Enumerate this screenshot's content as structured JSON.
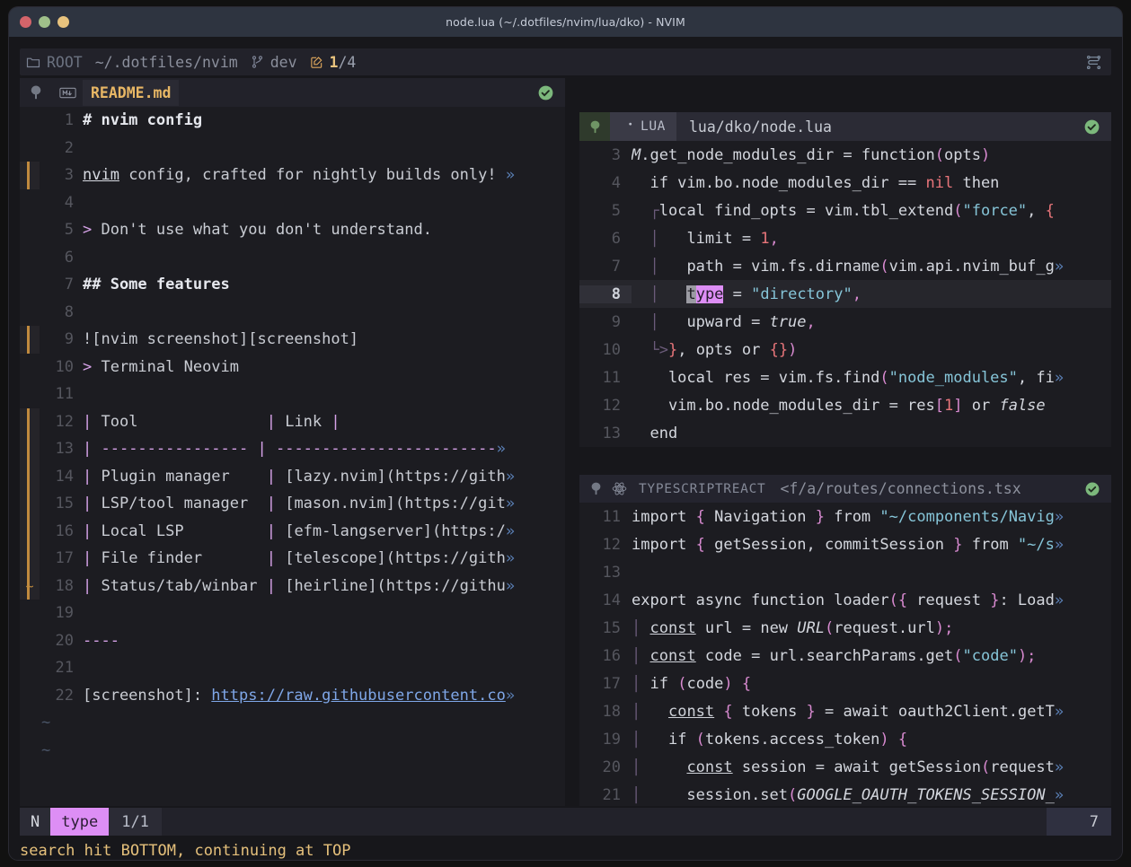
{
  "window": {
    "title": "node.lua (~/.dotfiles/nvim/lua/dko) - NVIM",
    "traffic_lights": [
      "close",
      "minimize",
      "maximize"
    ]
  },
  "tabline": {
    "folder_icon": "folder-icon",
    "root_label": "ROOT",
    "path": "~/.dotfiles/nvim",
    "branch_icon": "git-branch-icon",
    "branch": "dev",
    "edit_icon": "pencil-square-icon",
    "count_current": "1",
    "count_sep": "/4",
    "right_icon": "sitemap-icon"
  },
  "left_pane": {
    "winbar": {
      "tree_icon": "tree-icon",
      "filetype_icon": "markdown-icon",
      "filename": "README.md",
      "status_icon": "check-circle-icon"
    },
    "lines": [
      {
        "num": "1",
        "sign": "",
        "segments": [
          {
            "t": "# nvim config",
            "c": "md-h"
          }
        ]
      },
      {
        "num": "2",
        "sign": "",
        "segments": []
      },
      {
        "num": "3",
        "sign": "changed",
        "segments": [
          {
            "t": "nvim",
            "c": "md-link-u"
          },
          {
            "t": " config, crafted for nightly builds only! ",
            "c": "md-txt"
          },
          {
            "t": "»",
            "c": "wrapmark"
          }
        ]
      },
      {
        "num": "4",
        "sign": "",
        "segments": []
      },
      {
        "num": "5",
        "sign": "",
        "segments": [
          {
            "t": ">",
            "c": "md-quote"
          },
          {
            "t": " Don't use what you don't understand.",
            "c": "md-txt"
          }
        ]
      },
      {
        "num": "6",
        "sign": "",
        "segments": []
      },
      {
        "num": "7",
        "sign": "",
        "segments": [
          {
            "t": "## Some features",
            "c": "md-h"
          }
        ]
      },
      {
        "num": "8",
        "sign": "",
        "segments": []
      },
      {
        "num": "9",
        "sign": "changed",
        "segments": [
          {
            "t": "![nvim screenshot][screenshot]",
            "c": "md-txt"
          }
        ]
      },
      {
        "num": "10",
        "sign": "",
        "segments": [
          {
            "t": ">",
            "c": "md-quote"
          },
          {
            "t": " Terminal Neovim",
            "c": "md-txt"
          }
        ]
      },
      {
        "num": "11",
        "sign": "",
        "segments": []
      },
      {
        "num": "12",
        "sign": "changed",
        "segments": [
          {
            "t": "|",
            "c": "md-pipe"
          },
          {
            "t": " Tool              ",
            "c": "md-txt"
          },
          {
            "t": "|",
            "c": "md-pipe"
          },
          {
            "t": " Link ",
            "c": "md-txt"
          },
          {
            "t": "|",
            "c": "md-pipe"
          }
        ]
      },
      {
        "num": "13",
        "sign": "changed",
        "segments": [
          {
            "t": "|",
            "c": "md-pipe"
          },
          {
            "t": " ---------------- ",
            "c": "md-dash"
          },
          {
            "t": "|",
            "c": "md-pipe"
          },
          {
            "t": " ------------------------",
            "c": "md-dash"
          },
          {
            "t": "»",
            "c": "wrapmark"
          }
        ]
      },
      {
        "num": "14",
        "sign": "changed",
        "segments": [
          {
            "t": "|",
            "c": "md-pipe"
          },
          {
            "t": " Plugin manager    ",
            "c": "md-txt"
          },
          {
            "t": "|",
            "c": "md-pipe"
          },
          {
            "t": " [lazy.nvim](https://gith",
            "c": "md-txt"
          },
          {
            "t": "»",
            "c": "wrapmark"
          }
        ]
      },
      {
        "num": "15",
        "sign": "changed",
        "segments": [
          {
            "t": "|",
            "c": "md-pipe"
          },
          {
            "t": " LSP/tool manager  ",
            "c": "md-txt"
          },
          {
            "t": "|",
            "c": "md-pipe"
          },
          {
            "t": " [mason.nvim](https://git",
            "c": "md-txt"
          },
          {
            "t": "»",
            "c": "wrapmark"
          }
        ]
      },
      {
        "num": "16",
        "sign": "changed",
        "segments": [
          {
            "t": "|",
            "c": "md-pipe"
          },
          {
            "t": " Local LSP         ",
            "c": "md-txt"
          },
          {
            "t": "|",
            "c": "md-pipe"
          },
          {
            "t": " [efm-langserver](https:/",
            "c": "md-txt"
          },
          {
            "t": "»",
            "c": "wrapmark"
          }
        ]
      },
      {
        "num": "17",
        "sign": "changed",
        "segments": [
          {
            "t": "|",
            "c": "md-pipe"
          },
          {
            "t": " File finder       ",
            "c": "md-txt"
          },
          {
            "t": "|",
            "c": "md-pipe"
          },
          {
            "t": " [telescope](https://gith",
            "c": "md-txt"
          },
          {
            "t": "»",
            "c": "wrapmark"
          }
        ]
      },
      {
        "num": "18",
        "sign": "tilde-amber",
        "segments": [
          {
            "t": "|",
            "c": "md-pipe"
          },
          {
            "t": " Status/tab/winbar ",
            "c": "md-txt"
          },
          {
            "t": "|",
            "c": "md-pipe"
          },
          {
            "t": " [heirline](https://githu",
            "c": "md-txt"
          },
          {
            "t": "»",
            "c": "wrapmark"
          }
        ]
      },
      {
        "num": "19",
        "sign": "",
        "segments": []
      },
      {
        "num": "20",
        "sign": "",
        "segments": [
          {
            "t": "----",
            "c": "md-dash"
          }
        ]
      },
      {
        "num": "21",
        "sign": "",
        "segments": []
      },
      {
        "num": "22",
        "sign": "",
        "segments": [
          {
            "t": "[screenshot]: ",
            "c": "md-txt"
          },
          {
            "t": "https://raw.githubusercontent.co",
            "c": "md-url"
          },
          {
            "t": "»",
            "c": "wrapmark"
          }
        ]
      }
    ],
    "empty_markers": [
      "~",
      "~"
    ]
  },
  "lua_pane": {
    "winbar": {
      "tree_icon": "tree-icon",
      "lang_icon": "lua-moon-icon",
      "filetype": "LUA",
      "filepath": "lua/dko/node.lua",
      "status_icon": "check-circle-icon"
    },
    "lines": [
      {
        "num": "3",
        "cur": false,
        "segments": [
          {
            "t": "M",
            "c": "c-italic"
          },
          {
            "t": ".get_node_modules_dir = function",
            "c": "c-ident"
          },
          {
            "t": "(",
            "c": "c-paren"
          },
          {
            "t": "opts",
            "c": "c-ident"
          },
          {
            "t": ")",
            "c": "c-paren"
          }
        ]
      },
      {
        "num": "4",
        "cur": false,
        "segments": [
          {
            "t": "  if vim.bo.node_modules_dir == ",
            "c": "c-ident"
          },
          {
            "t": "nil",
            "c": "c-nil"
          },
          {
            "t": " then",
            "c": "c-ident"
          }
        ]
      },
      {
        "num": "5",
        "cur": false,
        "segments": [
          {
            "t": "  ",
            "c": "c-ident"
          },
          {
            "t": "┌",
            "c": "c-indent"
          },
          {
            "t": "local find_opts = vim.tbl_extend",
            "c": "c-ident"
          },
          {
            "t": "(",
            "c": "c-paren"
          },
          {
            "t": "\"force\"",
            "c": "c-str"
          },
          {
            "t": ", ",
            "c": "c-ident"
          },
          {
            "t": "{",
            "c": "c-brace"
          }
        ]
      },
      {
        "num": "6",
        "cur": false,
        "segments": [
          {
            "t": "  ",
            "c": "c-ident"
          },
          {
            "t": "│",
            "c": "c-indent"
          },
          {
            "t": "   limit = ",
            "c": "c-ident"
          },
          {
            "t": "1",
            "c": "c-num"
          },
          {
            "t": ",",
            "c": "c-paren"
          }
        ]
      },
      {
        "num": "7",
        "cur": false,
        "segments": [
          {
            "t": "  ",
            "c": "c-ident"
          },
          {
            "t": "│",
            "c": "c-indent"
          },
          {
            "t": "   path = vim.fs.dirname",
            "c": "c-ident"
          },
          {
            "t": "(",
            "c": "c-paren"
          },
          {
            "t": "vim.api.nvim_buf_g",
            "c": "c-ident"
          },
          {
            "t": "»",
            "c": "wrapmark"
          }
        ]
      },
      {
        "num": "8",
        "cur": true,
        "segments": [
          {
            "t": "  ",
            "c": "c-ident"
          },
          {
            "t": "│",
            "c": "c-indent"
          },
          {
            "t": "   ",
            "c": "c-ident"
          },
          {
            "t": "t",
            "c": "cursorblk"
          },
          {
            "t": "ype",
            "c": "sel"
          },
          {
            "t": " = ",
            "c": "c-ident"
          },
          {
            "t": "\"directory\"",
            "c": "c-str"
          },
          {
            "t": ",",
            "c": "c-paren"
          }
        ]
      },
      {
        "num": "9",
        "cur": false,
        "segments": [
          {
            "t": "  ",
            "c": "c-ident"
          },
          {
            "t": "│",
            "c": "c-indent"
          },
          {
            "t": "   upward = ",
            "c": "c-ident"
          },
          {
            "t": "true",
            "c": "c-italic"
          },
          {
            "t": ",",
            "c": "c-paren"
          }
        ]
      },
      {
        "num": "10",
        "cur": false,
        "segments": [
          {
            "t": "  ",
            "c": "c-ident"
          },
          {
            "t": "└>",
            "c": "c-indent"
          },
          {
            "t": "}",
            "c": "c-brace"
          },
          {
            "t": ", opts or ",
            "c": "c-ident"
          },
          {
            "t": "{}",
            "c": "c-brace"
          },
          {
            "t": ")",
            "c": "c-paren"
          }
        ]
      },
      {
        "num": "11",
        "cur": false,
        "segments": [
          {
            "t": "    local res = vim.fs.find",
            "c": "c-ident"
          },
          {
            "t": "(",
            "c": "c-paren"
          },
          {
            "t": "\"node_modules\"",
            "c": "c-str"
          },
          {
            "t": ", fi",
            "c": "c-ident"
          },
          {
            "t": "»",
            "c": "wrapmark"
          }
        ]
      },
      {
        "num": "12",
        "cur": false,
        "segments": [
          {
            "t": "    vim.bo.node_modules_dir = res",
            "c": "c-ident"
          },
          {
            "t": "[",
            "c": "c-paren"
          },
          {
            "t": "1",
            "c": "c-num"
          },
          {
            "t": "]",
            "c": "c-paren"
          },
          {
            "t": " or ",
            "c": "c-ident"
          },
          {
            "t": "false",
            "c": "c-italic"
          }
        ]
      },
      {
        "num": "13",
        "cur": false,
        "segments": [
          {
            "t": "  end",
            "c": "c-ident"
          }
        ]
      }
    ]
  },
  "tsx_pane": {
    "winbar": {
      "tree_icon": "tree-icon",
      "lang_icon": "react-atom-icon",
      "filetype": "TYPESCRIPTREACT",
      "filepath": "<f/a/routes/connections.tsx",
      "status_icon": "check-circle-icon"
    },
    "lines": [
      {
        "num": "11",
        "cur": false,
        "segments": [
          {
            "t": "import ",
            "c": "c-ident"
          },
          {
            "t": "{",
            "c": "c-paren"
          },
          {
            "t": " Navigation ",
            "c": "c-ident"
          },
          {
            "t": "}",
            "c": "c-paren"
          },
          {
            "t": " from ",
            "c": "c-ident"
          },
          {
            "t": "\"~/components/Navig",
            "c": "c-str"
          },
          {
            "t": "»",
            "c": "wrapmark"
          }
        ]
      },
      {
        "num": "12",
        "cur": false,
        "segments": [
          {
            "t": "import ",
            "c": "c-ident"
          },
          {
            "t": "{",
            "c": "c-paren"
          },
          {
            "t": " getSession, commitSession ",
            "c": "c-ident"
          },
          {
            "t": "}",
            "c": "c-paren"
          },
          {
            "t": " from ",
            "c": "c-ident"
          },
          {
            "t": "\"~/s",
            "c": "c-str"
          },
          {
            "t": "»",
            "c": "wrapmark"
          }
        ]
      },
      {
        "num": "13",
        "cur": false,
        "segments": []
      },
      {
        "num": "14",
        "cur": false,
        "segments": [
          {
            "t": "export async function loader",
            "c": "c-ident"
          },
          {
            "t": "({",
            "c": "c-paren"
          },
          {
            "t": " request ",
            "c": "c-ident"
          },
          {
            "t": "}",
            "c": "c-paren"
          },
          {
            "t": ": Load",
            "c": "c-ident"
          },
          {
            "t": "»",
            "c": "wrapmark"
          }
        ]
      },
      {
        "num": "15",
        "cur": false,
        "segments": [
          {
            "t": "│",
            "c": "c-indent"
          },
          {
            "t": " ",
            "c": "c-ident"
          },
          {
            "t": "const",
            "c": "c-const-u"
          },
          {
            "t": " url = new ",
            "c": "c-ident"
          },
          {
            "t": "URL",
            "c": "c-italic"
          },
          {
            "t": "(",
            "c": "c-paren"
          },
          {
            "t": "request.url",
            "c": "c-ident"
          },
          {
            "t": ");",
            "c": "c-paren"
          }
        ]
      },
      {
        "num": "16",
        "cur": false,
        "segments": [
          {
            "t": "│",
            "c": "c-indent"
          },
          {
            "t": " ",
            "c": "c-ident"
          },
          {
            "t": "const",
            "c": "c-const-u"
          },
          {
            "t": " code = url.searchParams.get",
            "c": "c-ident"
          },
          {
            "t": "(",
            "c": "c-paren"
          },
          {
            "t": "\"code\"",
            "c": "c-str"
          },
          {
            "t": ");",
            "c": "c-paren"
          }
        ]
      },
      {
        "num": "17",
        "cur": false,
        "segments": [
          {
            "t": "│",
            "c": "c-indent"
          },
          {
            "t": " if ",
            "c": "c-ident"
          },
          {
            "t": "(",
            "c": "c-paren"
          },
          {
            "t": "code",
            "c": "c-ident"
          },
          {
            "t": ") {",
            "c": "c-paren"
          }
        ]
      },
      {
        "num": "18",
        "cur": false,
        "segments": [
          {
            "t": "│",
            "c": "c-indent"
          },
          {
            "t": "   ",
            "c": "c-ident"
          },
          {
            "t": "const",
            "c": "c-const-u"
          },
          {
            "t": " ",
            "c": "c-ident"
          },
          {
            "t": "{",
            "c": "c-paren"
          },
          {
            "t": " tokens ",
            "c": "c-ident"
          },
          {
            "t": "}",
            "c": "c-paren"
          },
          {
            "t": " = await oauth2Client.getT",
            "c": "c-ident"
          },
          {
            "t": "»",
            "c": "wrapmark"
          }
        ]
      },
      {
        "num": "19",
        "cur": false,
        "segments": [
          {
            "t": "│",
            "c": "c-indent"
          },
          {
            "t": "   if ",
            "c": "c-ident"
          },
          {
            "t": "(",
            "c": "c-paren"
          },
          {
            "t": "tokens.access_token",
            "c": "c-ident"
          },
          {
            "t": ") {",
            "c": "c-paren"
          }
        ]
      },
      {
        "num": "20",
        "cur": false,
        "segments": [
          {
            "t": "│",
            "c": "c-indent"
          },
          {
            "t": "     ",
            "c": "c-ident"
          },
          {
            "t": "const",
            "c": "c-const-u"
          },
          {
            "t": " session = await getSession",
            "c": "c-ident"
          },
          {
            "t": "(",
            "c": "c-paren"
          },
          {
            "t": "request",
            "c": "c-ident"
          },
          {
            "t": "»",
            "c": "wrapmark"
          }
        ]
      },
      {
        "num": "21",
        "cur": false,
        "segments": [
          {
            "t": "│",
            "c": "c-indent"
          },
          {
            "t": "     session.set",
            "c": "c-ident"
          },
          {
            "t": "(",
            "c": "c-paren"
          },
          {
            "t": "GOOGLE_OAUTH_TOKENS_SESSION_",
            "c": "c-italic"
          },
          {
            "t": "»",
            "c": "wrapmark"
          }
        ]
      }
    ]
  },
  "statusline": {
    "mode": "N",
    "search_term": "type",
    "search_count": "1/1",
    "right_value": "7"
  },
  "cmdline": {
    "message": "search hit BOTTOM, continuing at TOP"
  },
  "colors": {
    "accent_search": "#dd8ef5",
    "filename_accent": "#e8b765",
    "git_change": "#c08a3e",
    "status_ok": "#7cb87c",
    "message": "#e5c07b"
  }
}
